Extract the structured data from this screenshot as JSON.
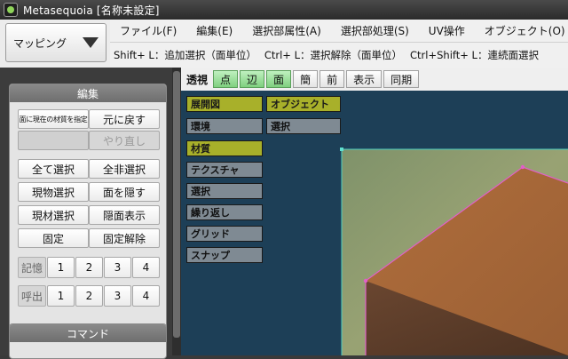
{
  "window": {
    "title": "Metasequoia [名称未設定]"
  },
  "mode": {
    "label": "マッピング"
  },
  "menu": [
    "ファイル(F)",
    "編集(E)",
    "選択部属性(A)",
    "選択部処理(S)",
    "UV操作",
    "オブジェクト(O)"
  ],
  "hints": [
    "Shift+ L：追加選択（面単位）",
    "Ctrl+ L：選択解除（面単位）",
    "Ctrl+Shift+ L：連続面選択"
  ],
  "edit_panel": {
    "title": "編集",
    "assign_material": "面に現在の材質を指定",
    "undo": "元に戻す",
    "redo": "やり直し",
    "select_all": "全て選択",
    "deselect_all": "全非選択",
    "select_object": "現物選択",
    "hide_face": "面を隠す",
    "select_material": "現材選択",
    "show_hidden": "隠面表示",
    "lock": "固定",
    "unlock": "固定解除",
    "memory_label": "記憶",
    "recall_label": "呼出",
    "slots": [
      "1",
      "2",
      "3",
      "4"
    ]
  },
  "command_panel": {
    "title": "コマンド"
  },
  "viewport_toolbar": {
    "label": "透視",
    "buttons": [
      {
        "label": "点",
        "active": true
      },
      {
        "label": "辺",
        "active": true
      },
      {
        "label": "面",
        "active": true
      },
      {
        "label": "簡",
        "active": false
      },
      {
        "label": "前",
        "active": false
      },
      {
        "label": "表示",
        "active": false
      },
      {
        "label": "同期",
        "active": false
      }
    ]
  },
  "layer_tags": {
    "col1": [
      {
        "label": "展開図",
        "active": true
      },
      {
        "label": "環境",
        "active": false
      },
      {
        "label": "材質",
        "active": true
      },
      {
        "label": "テクスチャ",
        "active": false
      },
      {
        "label": "選択",
        "active": false
      },
      {
        "label": "繰り返し",
        "active": false
      },
      {
        "label": "グリッド",
        "active": false
      },
      {
        "label": "スナップ",
        "active": false
      }
    ],
    "col2": [
      {
        "label": "オブジェクト",
        "active": true
      },
      {
        "label": "選択",
        "active": false
      }
    ]
  },
  "colors": {
    "viewport_bg": "#1d3f57",
    "texture_bg": "#8a9a6a",
    "box_top": "#a7683a",
    "box_side": "#5a3a27",
    "selection_edge": "#e060c8",
    "active_tag": "#a8b02a"
  }
}
